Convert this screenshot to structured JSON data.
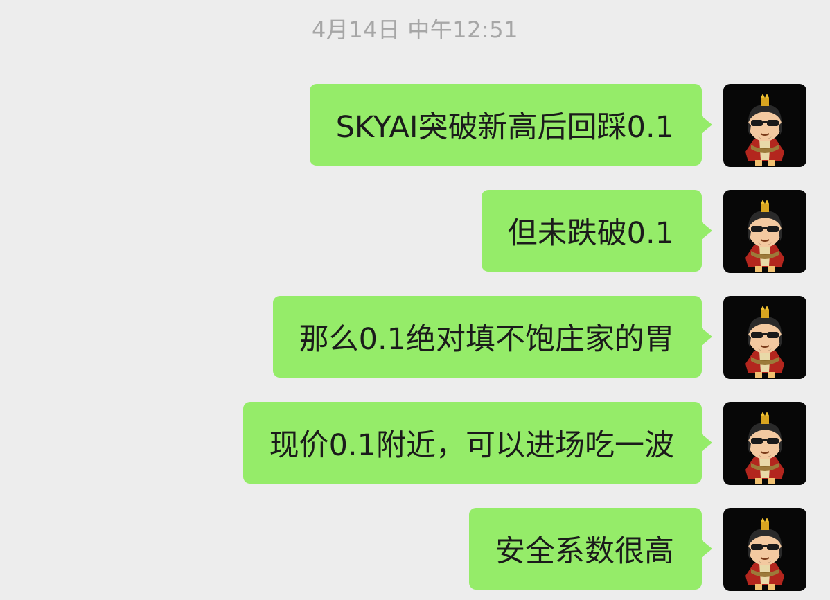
{
  "header": {
    "timestamp": "4月14日 中午12:51"
  },
  "messages": [
    {
      "sender": "self",
      "text": "SKYAI突破新高后回踩0.1",
      "avatar": "cartoon-king-sunglasses-avatar"
    },
    {
      "sender": "self",
      "text": "但未跌破0.1",
      "avatar": "cartoon-king-sunglasses-avatar"
    },
    {
      "sender": "self",
      "text": "那么0.1绝对填不饱庄家的胃",
      "avatar": "cartoon-king-sunglasses-avatar"
    },
    {
      "sender": "self",
      "text": "现价0.1附近，可以进场吃一波",
      "avatar": "cartoon-king-sunglasses-avatar"
    },
    {
      "sender": "self",
      "text": "安全系数很高",
      "avatar": "cartoon-king-sunglasses-avatar"
    }
  ],
  "colors": {
    "background": "#ededed",
    "bubble_self": "#95ec69",
    "timestamp_text": "#a6a6a6",
    "avatar_bg": "#070707"
  }
}
